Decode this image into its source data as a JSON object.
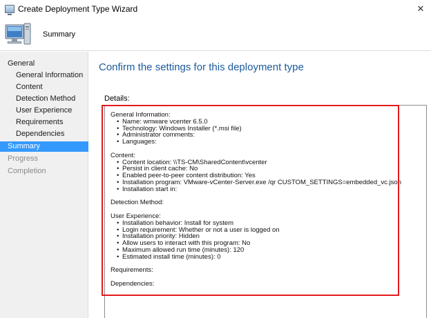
{
  "window": {
    "title": "Create Deployment Type Wizard",
    "close_glyph": "✕"
  },
  "header": {
    "page_title": "Summary"
  },
  "nav": {
    "items": [
      {
        "label": "General",
        "level": "top",
        "state": "normal"
      },
      {
        "label": "General Information",
        "level": "sub",
        "state": "normal"
      },
      {
        "label": "Content",
        "level": "sub",
        "state": "normal"
      },
      {
        "label": "Detection Method",
        "level": "sub",
        "state": "normal"
      },
      {
        "label": "User Experience",
        "level": "sub",
        "state": "normal"
      },
      {
        "label": "Requirements",
        "level": "sub",
        "state": "normal"
      },
      {
        "label": "Dependencies",
        "level": "sub",
        "state": "normal"
      },
      {
        "label": "Summary",
        "level": "top",
        "state": "selected"
      },
      {
        "label": "Progress",
        "level": "top",
        "state": "disabled"
      },
      {
        "label": "Completion",
        "level": "top",
        "state": "disabled"
      }
    ]
  },
  "main": {
    "heading": "Confirm the settings for this deployment type",
    "details_label": "Details:",
    "sections": [
      {
        "title": "General Information:",
        "items": [
          "Name: wmware vcenter 6.5.0",
          "Technology: Windows Installer (*.msi file)",
          "Administrator comments:",
          "Languages:"
        ]
      },
      {
        "title": "Content:",
        "items": [
          "Content location: \\\\TS-CM\\SharedContent\\vcenter",
          "Persist in client cache: No",
          "Enabled peer-to-peer content distribution: Yes",
          "Installation program: VMware-vCenter-Server.exe /qr CUSTOM_SETTINGS=embedded_vc.json",
          "Installation start in:"
        ]
      },
      {
        "title": "Detection Method:",
        "items": []
      },
      {
        "title": "User Experience:",
        "items": [
          "Installation behavior: Install for system",
          "Login requirement: Whether or not a user is logged on",
          "Installation priority: Hidden",
          "Allow users to interact with this program: No",
          "Maximum allowed run time (minutes): 120",
          "Estimated install time (minutes): 0"
        ]
      },
      {
        "title": "Requirements:",
        "items": []
      },
      {
        "title": "Dependencies:",
        "items": []
      }
    ]
  },
  "colors": {
    "heading": "#1a5a9c",
    "nav_selected": "#3399ff",
    "highlight_border": "#e3191c",
    "nav_background": "#f0f0f0"
  },
  "icons": {
    "app": "wizard-window-icon",
    "header": "computer-icon",
    "close": "close-icon"
  }
}
